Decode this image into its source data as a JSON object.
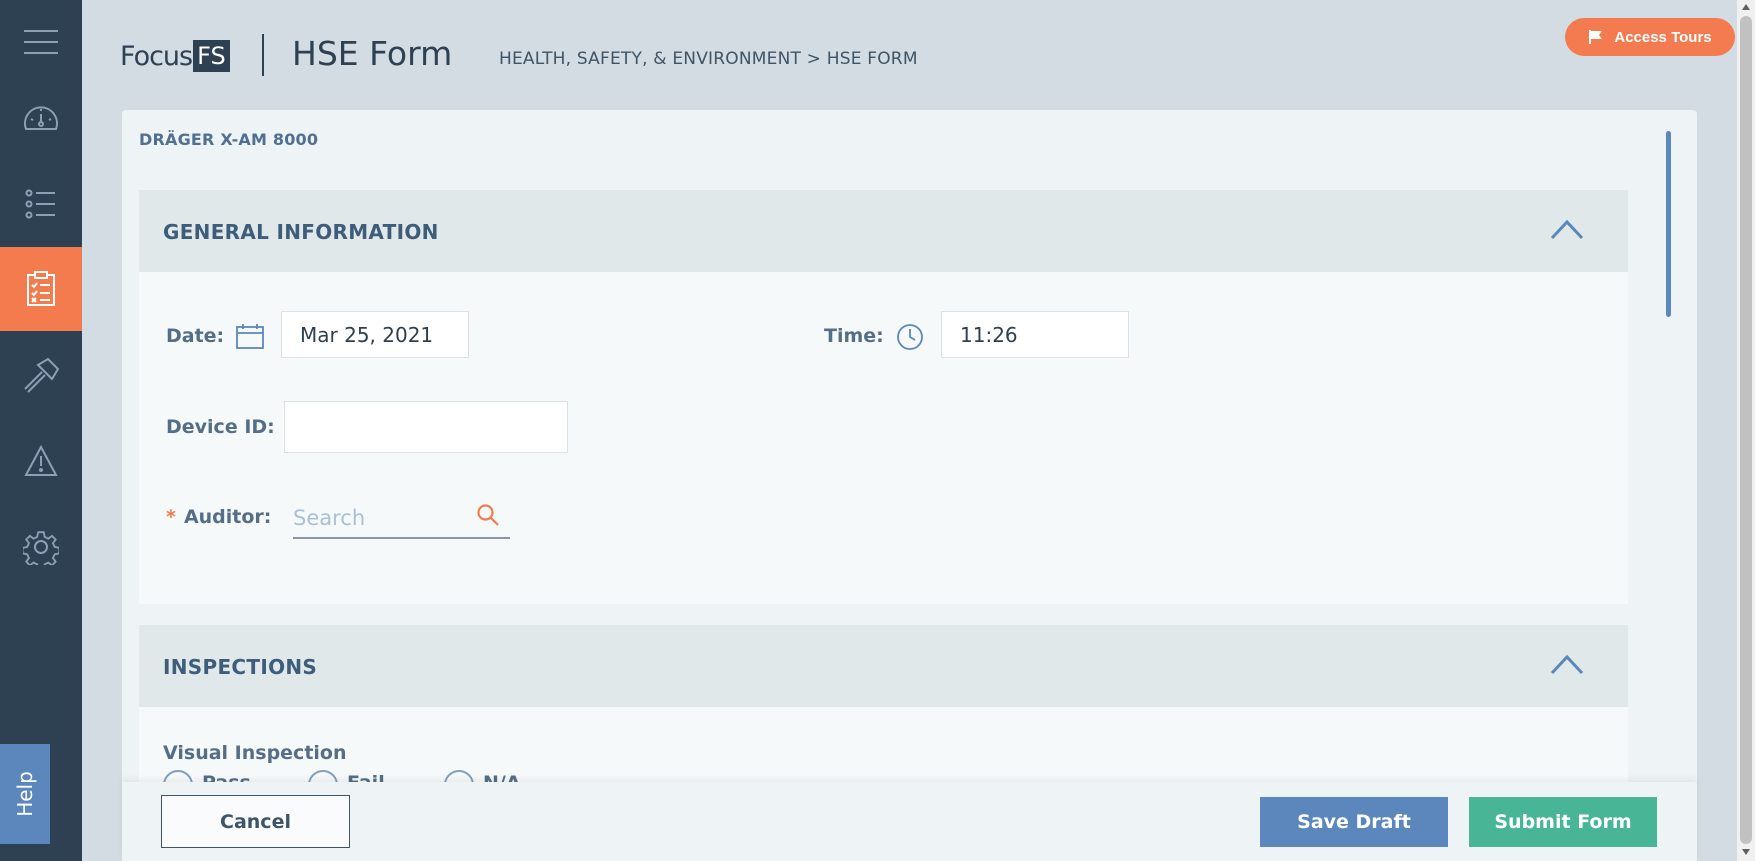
{
  "app": {
    "brand_focus": "Focus",
    "brand_fs": "FS",
    "page_title": "HSE Form"
  },
  "breadcrumb": "HEALTH, SAFETY, & ENVIRONMENT > HSE FORM",
  "access_tours": {
    "label": "Access Tours",
    "icon": "flag-icon"
  },
  "sidebar": {
    "items": [
      {
        "name": "menu",
        "icon": "hamburger-icon"
      },
      {
        "name": "dashboard",
        "icon": "speedometer-icon"
      },
      {
        "name": "list",
        "icon": "list-icon"
      },
      {
        "name": "forms",
        "icon": "clipboard-icon",
        "active": true
      },
      {
        "name": "tools",
        "icon": "hammer-icon"
      },
      {
        "name": "hazards",
        "icon": "warning-icon"
      },
      {
        "name": "settings",
        "icon": "gear-icon"
      }
    ],
    "help_label": "Help"
  },
  "device_title": "DRÄGER X-AM 8000",
  "general_information": {
    "title": "GENERAL INFORMATION",
    "date_label": "Date:",
    "date_value": "Mar 25, 2021",
    "time_label": "Time:",
    "time_value": "11:26",
    "device_id_label": "Device ID:",
    "device_id_value": "",
    "auditor_required": "*",
    "auditor_label": "Auditor:",
    "auditor_placeholder": "Search"
  },
  "inspections": {
    "title": "INSPECTIONS",
    "visual_inspection_label": "Visual Inspection",
    "options": [
      "Pass",
      "Fail",
      "N/A"
    ]
  },
  "footer": {
    "cancel_label": "Cancel",
    "save_draft_label": "Save Draft",
    "submit_label": "Submit Form"
  },
  "colors": {
    "sidebar": "#2e4152",
    "active": "#f37b4e",
    "primary": "#5b87bd",
    "success": "#48b596"
  }
}
